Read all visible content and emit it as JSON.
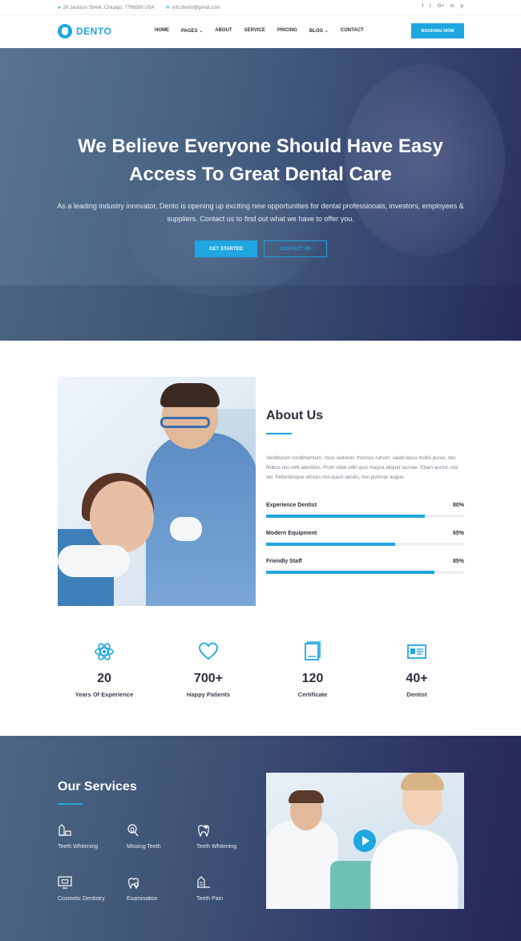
{
  "topbar": {
    "address": "26 Jackson Street, Chicago, 7796589 USA",
    "email": "info.dento@gmail.com",
    "social": [
      "f",
      "t",
      "G+",
      "in",
      "p"
    ]
  },
  "nav": {
    "brand": "DENTO",
    "items": [
      {
        "label": "HOME",
        "dropdown": false
      },
      {
        "label": "PAGES",
        "dropdown": true
      },
      {
        "label": "ABOUT",
        "dropdown": false
      },
      {
        "label": "SERVICE",
        "dropdown": false
      },
      {
        "label": "PRICING",
        "dropdown": false
      },
      {
        "label": "BLOG",
        "dropdown": true
      },
      {
        "label": "CONTACT",
        "dropdown": false
      }
    ],
    "cta": "BOOKING NOW"
  },
  "hero": {
    "title_line1": "We Believe Everyone Should Have Easy",
    "title_line2": "Access To Great Dental Care",
    "subtitle": "As a leading industry innovator, Dento is opening up exciting new opportunities for dental professionals, investors, employees & suppliers. Contact us to find out what we have to offer you.",
    "primary_button": "GET STARTED",
    "secondary_button": "CONTACT US"
  },
  "about": {
    "title": "About Us",
    "text": "Vestibulum condimentum, risus sedones rhoncus rutrum, salah lacus mollis purus, nec finibus nisi velit aderitisis. Proin vitae odin quis magna aliquet lacinae. Etiam auctor, nisl vel. Pellentesque ultrices nisl quam iaculis, nec pulvinar augue.",
    "skills": [
      {
        "label": "Experience Dentist",
        "percent_label": "80%",
        "value": 80
      },
      {
        "label": "Modern Equipment",
        "percent_label": "65%",
        "value": 65
      },
      {
        "label": "Friendly Staff",
        "percent_label": "85%",
        "value": 85
      }
    ]
  },
  "stats": [
    {
      "icon": "atom-icon",
      "number": "20",
      "label": "Years Of Experience"
    },
    {
      "icon": "heart-icon",
      "number": "700+",
      "label": "Happy Patients"
    },
    {
      "icon": "certificate-icon",
      "number": "120",
      "label": "Certificate"
    },
    {
      "icon": "id-card-icon",
      "number": "40+",
      "label": "Dentist"
    }
  ],
  "services": {
    "title": "Our Services",
    "items": [
      {
        "icon": "whitening-icon",
        "label": "Teeth Whitening"
      },
      {
        "icon": "missing-tooth-icon",
        "label": "Missing Teeth"
      },
      {
        "icon": "whitening-tooth-icon",
        "label": "Teeth Whitening"
      },
      {
        "icon": "monitor-icon",
        "label": "Cosmetic Dentistry"
      },
      {
        "icon": "examination-icon",
        "label": "Examination"
      },
      {
        "icon": "teeth-pain-icon",
        "label": "Teeth Pain"
      }
    ]
  },
  "colors": {
    "accent": "#1ea7e1",
    "hero_dark": "#25295a",
    "text_dark": "#2b2f3a"
  }
}
